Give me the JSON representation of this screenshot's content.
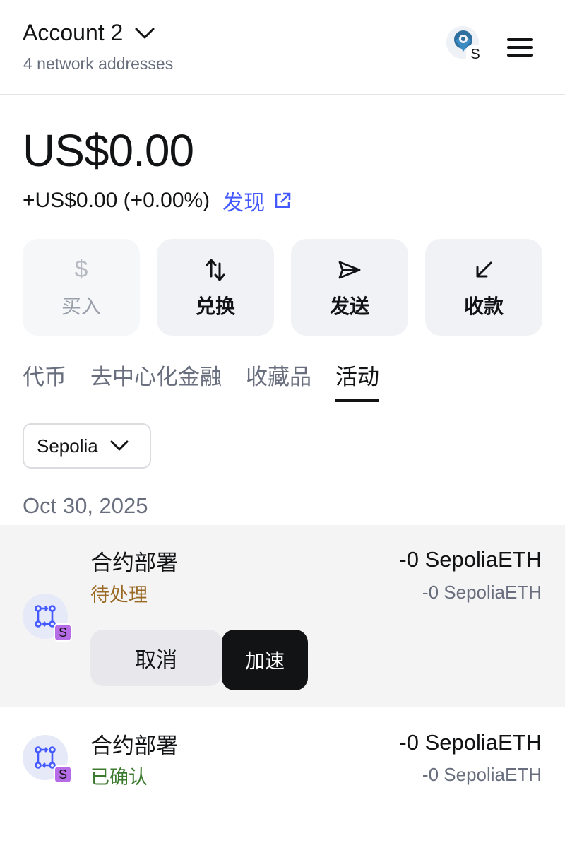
{
  "header": {
    "account_name": "Account 2",
    "network_addresses": "4 network addresses",
    "network_badge": "S"
  },
  "balance": {
    "amount": "US$0.00",
    "change": "+US$0.00 (+0.00%)",
    "discover_label": "发现"
  },
  "actions": [
    {
      "label": "买入",
      "icon": "dollar-icon",
      "enabled": false
    },
    {
      "label": "兑换",
      "icon": "swap-icon",
      "enabled": true
    },
    {
      "label": "发送",
      "icon": "send-icon",
      "enabled": true
    },
    {
      "label": "收款",
      "icon": "receive-icon",
      "enabled": true
    }
  ],
  "tabs": [
    {
      "label": "代币",
      "active": false
    },
    {
      "label": "去中心化金融",
      "active": false
    },
    {
      "label": "收藏品",
      "active": false
    },
    {
      "label": "活动",
      "active": true
    }
  ],
  "filter": {
    "selected": "Sepolia"
  },
  "activity": {
    "date": "Oct 30, 2025",
    "items": [
      {
        "title": "合约部署",
        "status": "待处理",
        "amount": "-0 SepoliaETH",
        "fiat": "-0 SepoliaETH",
        "badge": "S",
        "cancel_label": "取消",
        "speed_up_label": "加速"
      },
      {
        "title": "合约部署",
        "status": "已确认",
        "amount": "-0 SepoliaETH",
        "fiat": "-0 SepoliaETH",
        "badge": "S"
      }
    ]
  },
  "colors": {
    "accent": "#4459ff",
    "pending": "#9a6a25",
    "confirmed": "#3c7a2e",
    "badge": "#b66ce6"
  }
}
